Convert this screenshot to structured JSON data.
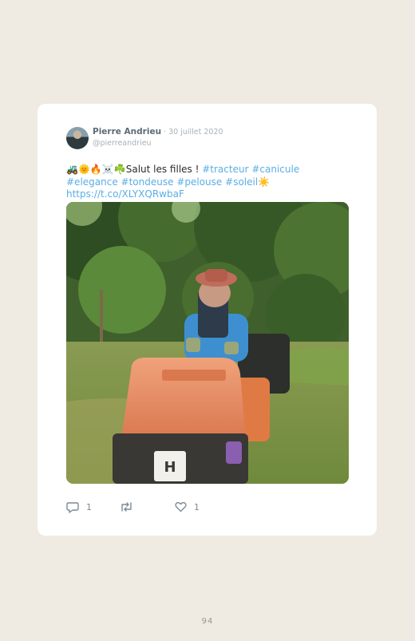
{
  "tweet": {
    "author_name": "Pierre Andrieu",
    "separator": " · ",
    "date": "30 juillet 2020",
    "handle": "@pierreandrieu",
    "text_emoji": "🚜🌞🔥☠️☘️",
    "text_main": "Salut les filles ! ",
    "hashtags": [
      "#tracteur",
      "#canicule",
      "#elegance",
      "#tondeuse",
      "#pelouse",
      "#soleil"
    ],
    "sun_emoji": "☀️",
    "link": "https://t.co/XLYXQRwbaF",
    "replies": "1",
    "retweets": "",
    "likes": "1"
  },
  "icons": {
    "reply": "reply-icon",
    "retweet": "retweet-icon",
    "like": "heart-icon"
  },
  "colors": {
    "page_background": "#efebe2",
    "card": "#ffffff",
    "link": "#5aaee6",
    "mower": "#e8845a"
  },
  "page_number": "94"
}
